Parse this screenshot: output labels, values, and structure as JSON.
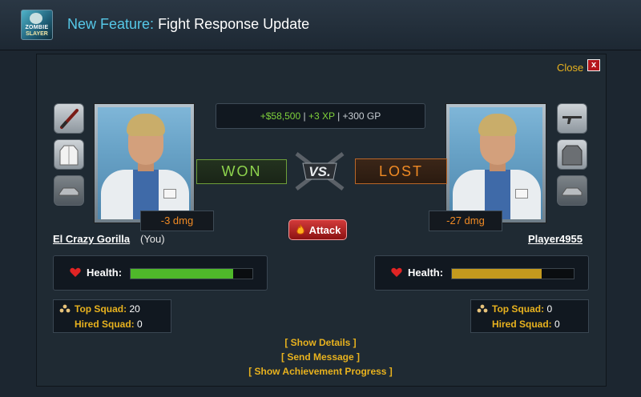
{
  "header": {
    "logo_line1": "ZOMBIE",
    "logo_line2": "SLAYER",
    "title_prefix": "New Feature:",
    "title_rest": "Fight Response Update"
  },
  "dialog": {
    "close_label": "Close",
    "close_x": "x",
    "rewards": {
      "cash": "+$58,500",
      "sep1": " | ",
      "xp": "+3 XP",
      "sep2": " | ",
      "gp": "+300 GP"
    },
    "result_left": "WON",
    "result_right": "LOST",
    "attack_label": "Attack",
    "player": {
      "name": "El Crazy Gorilla",
      "suffix": "(You)",
      "damage": "-3 dmg",
      "health_label": "Health:",
      "health_fraction": 0.84,
      "health_color": "#4fb82a",
      "top_squad_label": "Top Squad:",
      "top_squad_value": "20",
      "hired_squad_label": "Hired Squad:",
      "hired_squad_value": "0",
      "equipment_icons": [
        "bat-icon",
        "lab-coat-icon",
        "car-icon"
      ]
    },
    "opponent": {
      "name": "Player4955",
      "damage": "-27 dmg",
      "health_label": "Health:",
      "health_fraction": 0.74,
      "health_color": "#c49a1e",
      "top_squad_label": "Top Squad:",
      "top_squad_value": "0",
      "hired_squad_label": "Hired Squad:",
      "hired_squad_value": "0",
      "equipment_icons": [
        "rifle-icon",
        "jacket-icon",
        "car-icon"
      ]
    },
    "links": {
      "details": "[ Show Details ]",
      "message": "[ Send Message ]",
      "achievements": "[ Show Achievement Progress ]"
    }
  }
}
